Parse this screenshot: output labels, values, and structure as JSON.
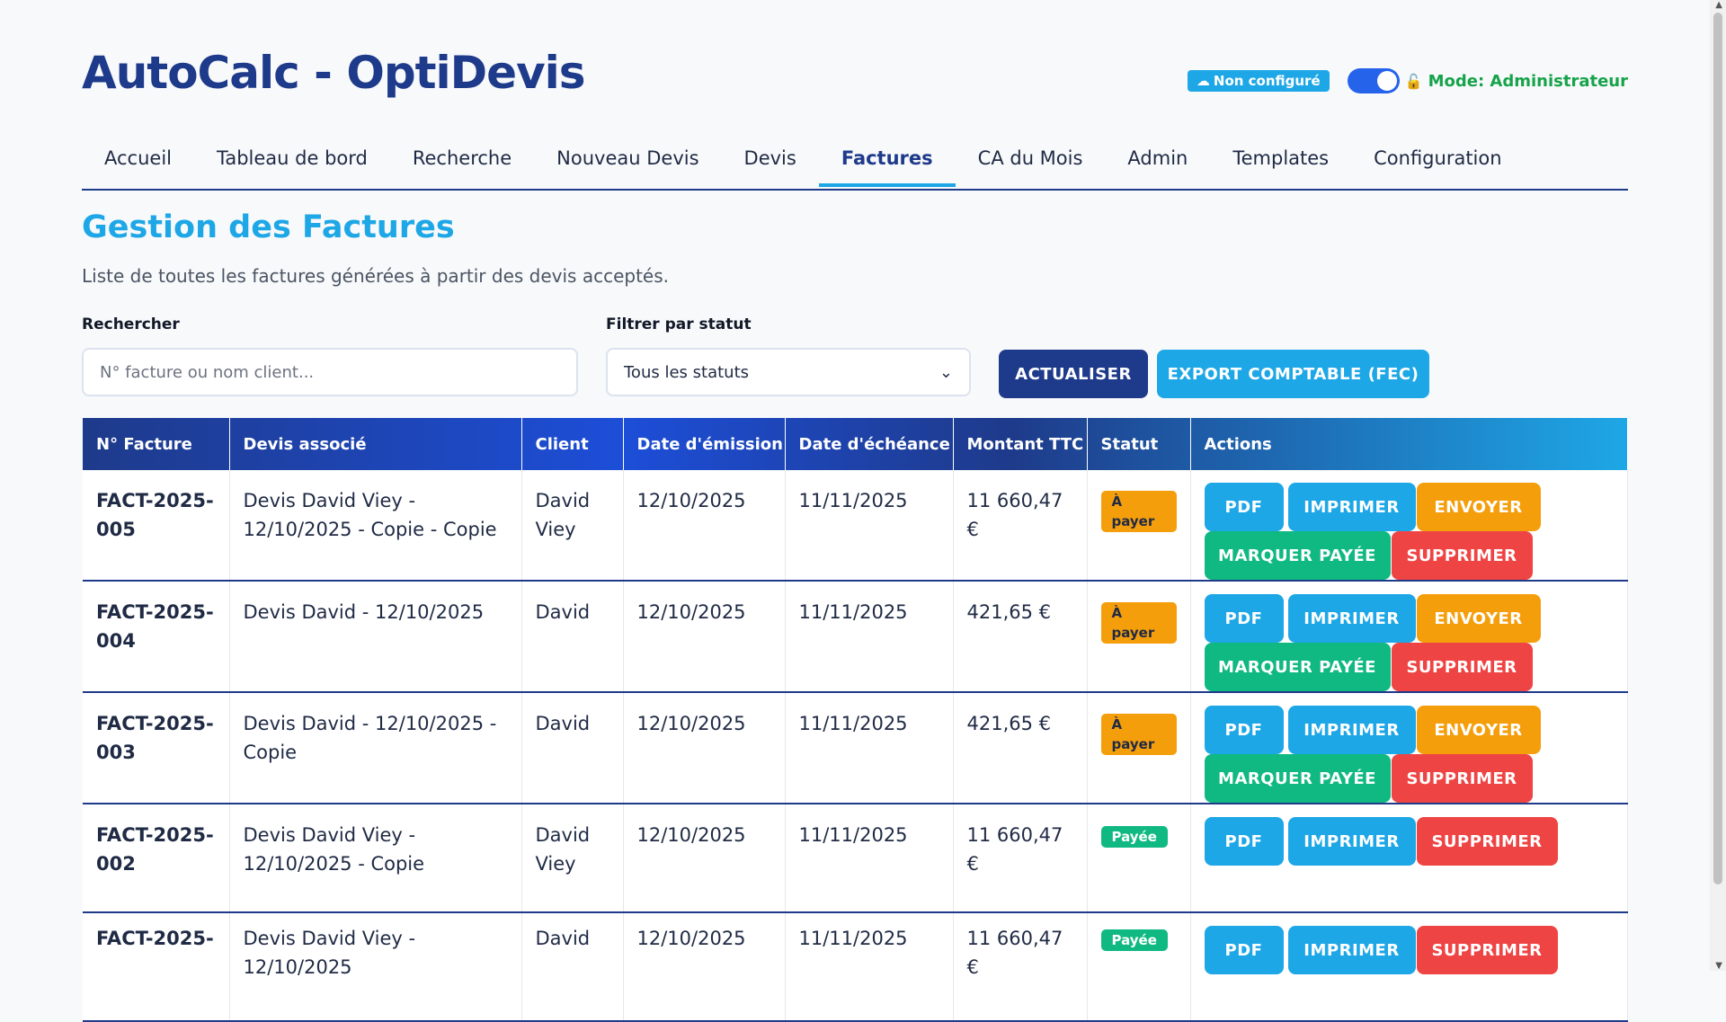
{
  "app": {
    "title": "AutoCalc - OptiDevis"
  },
  "header": {
    "cloud_badge": "Non configuré",
    "mode_label": "Mode: Administrateur"
  },
  "nav": {
    "tabs": [
      {
        "label": "Accueil"
      },
      {
        "label": "Tableau de bord"
      },
      {
        "label": "Recherche"
      },
      {
        "label": "Nouveau Devis"
      },
      {
        "label": "Devis"
      },
      {
        "label": "Factures",
        "active": true
      },
      {
        "label": "CA du Mois"
      },
      {
        "label": "Admin"
      },
      {
        "label": "Templates"
      },
      {
        "label": "Configuration"
      }
    ]
  },
  "section": {
    "title": "Gestion des Factures",
    "description": "Liste de toutes les factures générées à partir des devis acceptés."
  },
  "filters": {
    "search_label": "Rechercher",
    "search_placeholder": "N° facture ou nom client...",
    "status_label": "Filtrer par statut",
    "status_value": "Tous les statuts"
  },
  "buttons": {
    "refresh": "ACTUALISER",
    "export": "EXPORT COMPTABLE (FEC)"
  },
  "table": {
    "headers": [
      "N° Facture",
      "Devis associé",
      "Client",
      "Date d'émission",
      "Date d'échéance",
      "Montant TTC",
      "Statut",
      "Actions"
    ],
    "rows": [
      {
        "num": "FACT-2025-005",
        "devis": "Devis David Viey - 12/10/2025 - Copie - Copie",
        "client": "David Viey",
        "emission": "12/10/2025",
        "echeance": "11/11/2025",
        "montant": "11 660,47 €",
        "statut": "À payer"
      },
      {
        "num": "FACT-2025-004",
        "devis": "Devis David - 12/10/2025",
        "client": "David",
        "emission": "12/10/2025",
        "echeance": "11/11/2025",
        "montant": "421,65 €",
        "statut": "À payer"
      },
      {
        "num": "FACT-2025-003",
        "devis": "Devis David - 12/10/2025 - Copie",
        "client": "David",
        "emission": "12/10/2025",
        "echeance": "11/11/2025",
        "montant": "421,65 €",
        "statut": "À payer"
      },
      {
        "num": "FACT-2025-002",
        "devis": "Devis David Viey - 12/10/2025 - Copie",
        "client": "David Viey",
        "emission": "12/10/2025",
        "echeance": "11/11/2025",
        "montant": "11 660,47 €",
        "statut": "Payée"
      },
      {
        "num": "FACT-2025-",
        "devis": "Devis David Viey - 12/10/2025",
        "client": "David",
        "emission": "12/10/2025",
        "echeance": "11/11/2025",
        "montant": "11 660,47 €",
        "statut": "Payée"
      }
    ],
    "actions": {
      "pdf": "PDF",
      "print": "IMPRIMER",
      "send": "ENVOYER",
      "mark_paid": "MARQUER PAYÉE",
      "delete": "SUPPRIMER"
    }
  },
  "colors": {
    "primary": "#1e3a8a",
    "accent": "#1ea7e6",
    "warning": "#f59e0b",
    "success": "#10b981",
    "danger": "#ef4444"
  }
}
